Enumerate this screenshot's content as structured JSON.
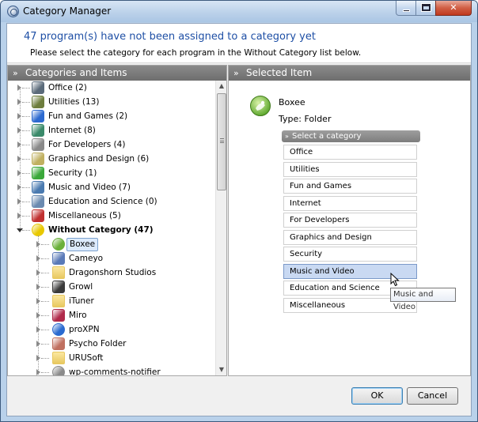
{
  "window": {
    "title": "Category Manager",
    "minimize_glyph": "",
    "close_glyph": "✕"
  },
  "header": {
    "main": "47 program(s) have not been assigned to a category yet",
    "sub": "Please select the category for each program in the Without Category list below."
  },
  "left_pane": {
    "title": "Categories and Items",
    "categories": [
      {
        "label": "Office (2)",
        "icon": "office-icon",
        "color": "#5a6a7a"
      },
      {
        "label": "Utilities (13)",
        "icon": "utilities-icon",
        "color": "#6d7d3d"
      },
      {
        "label": "Fun and Games (2)",
        "icon": "games-icon",
        "color": "#2d6ad0"
      },
      {
        "label": "Internet (8)",
        "icon": "internet-icon",
        "color": "#3a8a6a"
      },
      {
        "label": "For Developers (4)",
        "icon": "developers-icon",
        "color": "#8a8a8a"
      },
      {
        "label": "Graphics and Design (6)",
        "icon": "graphics-icon",
        "color": "#c0b060"
      },
      {
        "label": "Security (1)",
        "icon": "security-icon",
        "color": "#3aa83a"
      },
      {
        "label": "Music and Video (7)",
        "icon": "music-icon",
        "color": "#4a7ab0"
      },
      {
        "label": "Education and Science (0)",
        "icon": "education-icon",
        "color": "#6a8ab0"
      },
      {
        "label": "Miscellaneous (5)",
        "icon": "miscellaneous-icon",
        "color": "#c03030"
      }
    ],
    "without_category": {
      "label": "Without Category (47)",
      "icon": "lightbulb-icon",
      "color": "#e8c800"
    },
    "items": [
      {
        "label": "Boxee",
        "icon": "boxee-icon",
        "color": "#6ab03a"
      },
      {
        "label": "Cameyo",
        "icon": "cameyo-icon",
        "color": "#5a7ab8"
      },
      {
        "label": "Dragonshorn Studios",
        "icon": "folder-icon",
        "color": "#e8c860"
      },
      {
        "label": "Growl",
        "icon": "growl-icon",
        "color": "#3a3a3a"
      },
      {
        "label": "iTuner",
        "icon": "folder-icon",
        "color": "#e8c860"
      },
      {
        "label": "Miro",
        "icon": "miro-icon",
        "color": "#b02a4a"
      },
      {
        "label": "proXPN",
        "icon": "proxpn-icon",
        "color": "#2a6ad0"
      },
      {
        "label": "Psycho Folder",
        "icon": "psycho-folder-icon",
        "color": "#c07060"
      },
      {
        "label": "URUSoft",
        "icon": "folder-icon",
        "color": "#e8c860"
      },
      {
        "label": "wp-comments-notifier",
        "icon": "wordpress-icon",
        "color": "#8a8a8a"
      }
    ],
    "scroll_grip": ""
  },
  "right_pane": {
    "title": "Selected Item",
    "app_name": "Boxee",
    "app_type": "Type: Folder",
    "select_header": "Select a category",
    "options": [
      "Office",
      "Utilities",
      "Fun and Games",
      "Internet",
      "For Developers",
      "Graphics and Design",
      "Security",
      "Music and Video",
      "Education and Science",
      "Miscellaneous"
    ],
    "hovered_option": "Music and Video",
    "tooltip": "Music and Video"
  },
  "buttons": {
    "ok": "OK",
    "cancel": "Cancel"
  },
  "colors": {
    "accent_text": "#1e4fa5",
    "pane_header": "#7a7a7a",
    "hover": "#c9d9f2"
  }
}
